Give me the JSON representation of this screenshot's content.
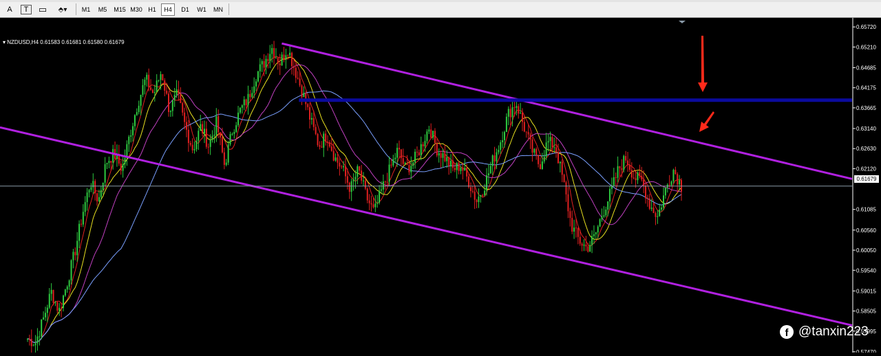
{
  "toolbar": {
    "tools": [
      {
        "name": "text-tool",
        "glyph": "A"
      },
      {
        "name": "text-label-tool",
        "glyph": "T"
      },
      {
        "name": "label-tool",
        "glyph": "▭"
      },
      {
        "name": "shapes-tool",
        "glyph": "⬘▾"
      }
    ],
    "timeframes": [
      "M1",
      "M5",
      "M15",
      "M30",
      "H1",
      "H4",
      "D1",
      "W1",
      "MN"
    ],
    "active_timeframe": "H4"
  },
  "chart": {
    "symbol_info": "NZDUSD,H4  0.61583 0.61681 0.61580 0.61679",
    "current_price": "0.61679",
    "price_labels": [
      "0.65720",
      "0.65210",
      "0.64685",
      "0.64175",
      "0.63665",
      "0.63140",
      "0.62630",
      "0.62120",
      "0.61085",
      "0.60560",
      "0.60050",
      "0.59540",
      "0.59015",
      "0.58505",
      "0.57995",
      "0.57470"
    ],
    "watermark": "@tanxin223",
    "colors": {
      "background": "#000000",
      "bull_candle": "#2ecc40",
      "bear_candle": "#e02020",
      "channel": "#b020e0",
      "resistance": "#0b0b9e",
      "arrow": "#ff2a1a",
      "price_line": "#8a9aa8"
    }
  },
  "chart_data": {
    "type": "line",
    "symbol": "NZDUSD",
    "timeframe": "H4",
    "ohlc_last": {
      "open": 0.61583,
      "high": 0.61681,
      "low": 0.6158,
      "close": 0.61679
    },
    "ylim": [
      0.5745,
      0.6595
    ],
    "y_ticks": [
      0.6572,
      0.6521,
      0.64685,
      0.64175,
      0.63665,
      0.6314,
      0.6263,
      0.6212,
      0.61085,
      0.6056,
      0.6005,
      0.5954,
      0.59015,
      0.58505,
      0.57995,
      0.5747
    ],
    "price_path": [
      0.578,
      0.577,
      0.583,
      0.59,
      0.585,
      0.592,
      0.6,
      0.61,
      0.618,
      0.613,
      0.623,
      0.625,
      0.621,
      0.63,
      0.638,
      0.644,
      0.64,
      0.646,
      0.636,
      0.64,
      0.632,
      0.626,
      0.632,
      0.627,
      0.633,
      0.622,
      0.631,
      0.636,
      0.639,
      0.645,
      0.648,
      0.652,
      0.648,
      0.652,
      0.646,
      0.64,
      0.633,
      0.627,
      0.63,
      0.624,
      0.621,
      0.616,
      0.621,
      0.614,
      0.61,
      0.616,
      0.621,
      0.626,
      0.621,
      0.623,
      0.627,
      0.632,
      0.626,
      0.624,
      0.621,
      0.622,
      0.618,
      0.613,
      0.617,
      0.623,
      0.628,
      0.635,
      0.638,
      0.632,
      0.626,
      0.622,
      0.628,
      0.627,
      0.618,
      0.607,
      0.603,
      0.601,
      0.604,
      0.61,
      0.615,
      0.621,
      0.624,
      0.619,
      0.618,
      0.612,
      0.609,
      0.616,
      0.621,
      0.6168
    ],
    "channel_upper": [
      [
        0.3307,
        0.653
      ],
      [
        1.0,
        0.6186
      ]
    ],
    "channel_lower": [
      [
        0.0,
        0.6317
      ],
      [
        1.0,
        0.5814
      ]
    ],
    "resistance": [
      [
        0.3508,
        0.6386
      ],
      [
        1.0,
        0.6386
      ]
    ],
    "current_price_line": 0.61679
  }
}
